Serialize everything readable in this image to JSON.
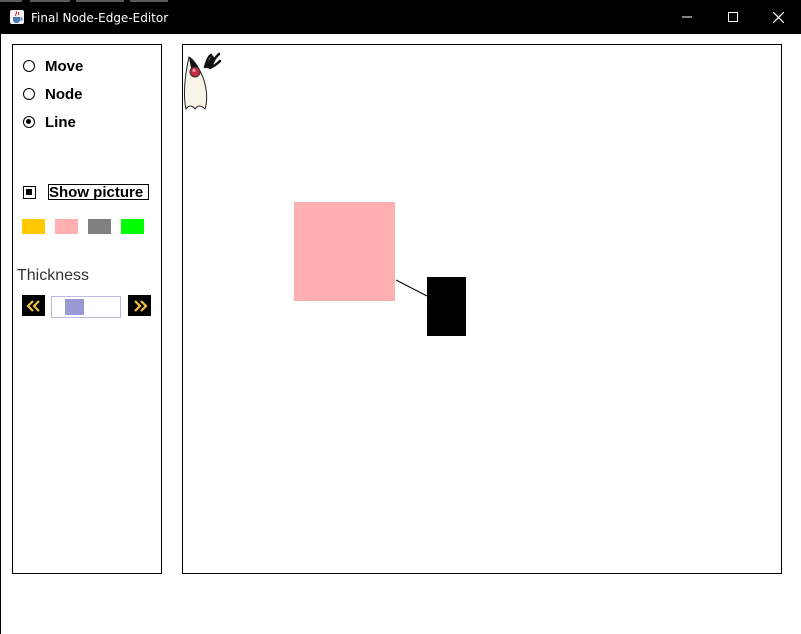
{
  "window": {
    "title": "Final Node-Edge-Editor",
    "app_icon": "java-cup-icon",
    "controls": [
      "minimize-icon",
      "maximize-icon",
      "close-icon"
    ]
  },
  "panel": {
    "modes": [
      {
        "label": "Move",
        "selected": false
      },
      {
        "label": "Node",
        "selected": false
      },
      {
        "label": "Line",
        "selected": true
      }
    ],
    "show_picture": {
      "label": "Show picture",
      "checked": true
    },
    "colors": [
      "#ffc800",
      "#ffafaf",
      "#808080",
      "#00ff00"
    ],
    "thickness": {
      "label": "Thickness",
      "decrease_icon": "double-chevron-left-icon",
      "increase_icon": "double-chevron-right-icon",
      "value_fraction": 0.25
    }
  },
  "canvas": {
    "picture": "duke-mascot-icon",
    "nodes": [
      {
        "id": "node-pink",
        "color": "#ffafaf"
      },
      {
        "id": "node-black",
        "color": "#000000"
      }
    ],
    "edges": [
      {
        "from": "node-pink",
        "to": "node-black",
        "color": "#000000"
      }
    ]
  }
}
